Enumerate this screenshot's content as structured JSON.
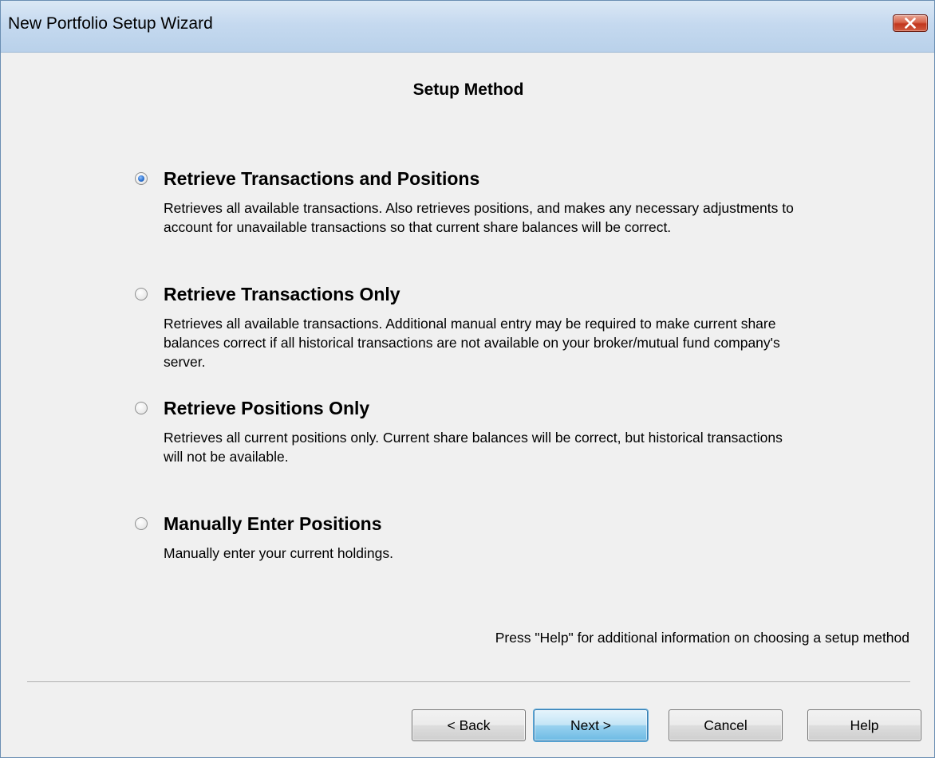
{
  "window": {
    "title": "New Portfolio Setup Wizard",
    "close_icon": "close-icon"
  },
  "page": {
    "heading": "Setup Method"
  },
  "options": [
    {
      "label": "Retrieve Transactions and Positions",
      "description": "Retrieves all available transactions.  Also retrieves positions, and makes any necessary adjustments to account for unavailable transactions so that current share balances will be correct.",
      "selected": true
    },
    {
      "label": "Retrieve Transactions Only",
      "description": "Retrieves all available transactions.  Additional manual entry may be required to make current share balances correct if all historical transactions are not available on your broker/mutual fund company's server.",
      "selected": false
    },
    {
      "label": "Retrieve Positions Only",
      "description": "Retrieves all current positions only.  Current share balances will be correct, but historical transactions will not be available.",
      "selected": false
    },
    {
      "label": "Manually Enter Positions",
      "description": "Manually enter your current holdings.",
      "selected": false
    }
  ],
  "help_note": "Press \"Help\" for additional information on choosing a setup method",
  "buttons": {
    "back": "< Back",
    "next": "Next >",
    "cancel": "Cancel",
    "help": "Help"
  },
  "colors": {
    "titlebar": "#c5d9ef",
    "window_bg": "#f0f0f0",
    "close_button": "#c2361d",
    "default_button": "#98d1ef"
  }
}
